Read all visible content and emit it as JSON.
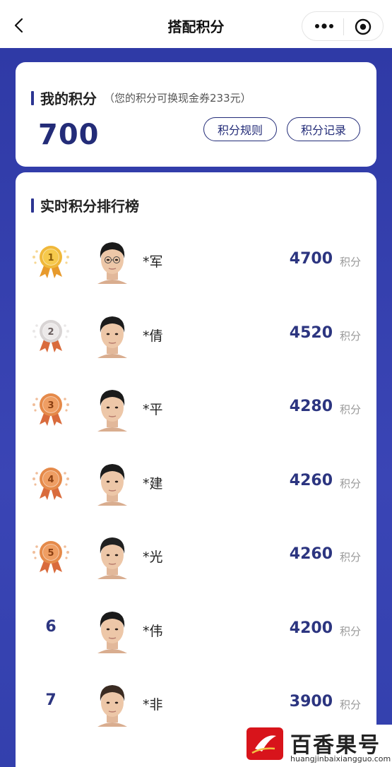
{
  "nav": {
    "title": "搭配积分"
  },
  "points": {
    "title": "我的积分",
    "note": "（您的积分可换现金券233元）",
    "value": "700",
    "rules_button": "积分规则",
    "record_button": "积分记录"
  },
  "ranking": {
    "title": "实时积分排行榜",
    "unit": "积分",
    "rows": [
      {
        "rank": "1",
        "medal": "gold",
        "name": "*军",
        "score": "4700"
      },
      {
        "rank": "2",
        "medal": "silver",
        "name": "*倩",
        "score": "4520"
      },
      {
        "rank": "3",
        "medal": "bronze",
        "name": "*平",
        "score": "4280"
      },
      {
        "rank": "4",
        "medal": "bronze",
        "name": "*建",
        "score": "4260"
      },
      {
        "rank": "5",
        "medal": "bronze",
        "name": "*光",
        "score": "4260"
      },
      {
        "rank": "6",
        "medal": "",
        "name": "*伟",
        "score": "4200"
      },
      {
        "rank": "7",
        "medal": "",
        "name": "*非",
        "score": "3900"
      }
    ]
  },
  "watermark": {
    "text": "百香果号",
    "url": "huangjinbaixiangguo.com"
  },
  "colors": {
    "accent": "#232c78",
    "panel": "#3a45b5"
  }
}
